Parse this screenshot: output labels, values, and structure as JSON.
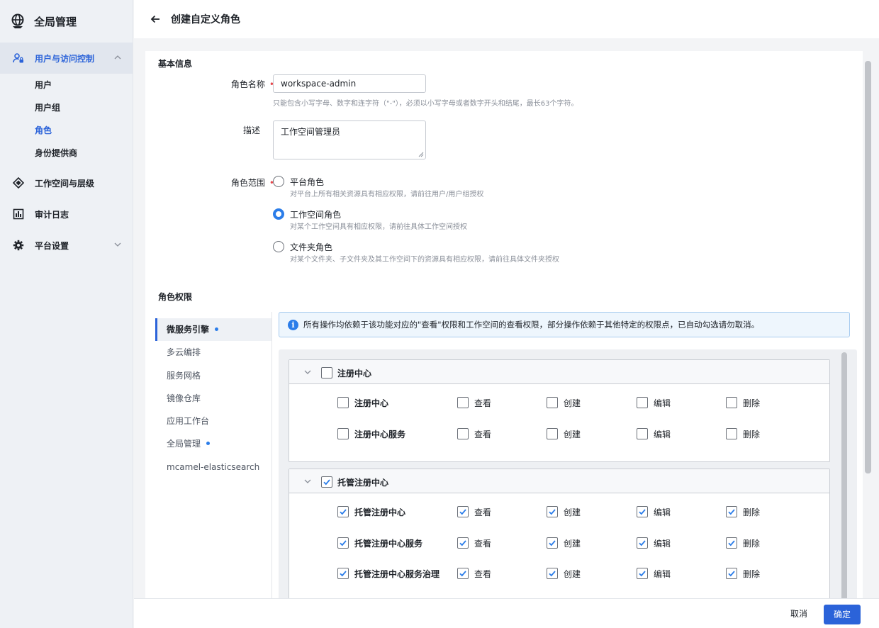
{
  "sidebar": {
    "brand": "全局管理",
    "groups": [
      {
        "label": "用户与访问控制"
      },
      {
        "label": "工作空间与层级"
      },
      {
        "label": "审计日志"
      },
      {
        "label": "平台设置"
      }
    ],
    "sub_items": [
      {
        "label": "用户"
      },
      {
        "label": "用户组"
      },
      {
        "label": "角色"
      },
      {
        "label": "身份提供商"
      }
    ]
  },
  "header": {
    "title": "创建自定义角色"
  },
  "basic": {
    "section_title": "基本信息",
    "name_label": "角色名称",
    "name_value": "workspace-admin",
    "name_hint": "只能包含小写字母、数字和连字符（\"-\"），必须以小写字母或者数字开头和结尾，最长63个字符。",
    "desc_label": "描述",
    "desc_value": "工作空间管理员",
    "scope_label": "角色范围",
    "scopes": [
      {
        "title": "平台角色",
        "desc": "对平台上所有相关资源具有相应权限，请前往用户/用户组授权",
        "checked": false
      },
      {
        "title": "工作空间角色",
        "desc": "对某个工作空间具有相应权限，请前往具体工作空间授权",
        "checked": true
      },
      {
        "title": "文件夹角色",
        "desc": "对某个文件夹、子文件夹及其工作空间下的资源具有相应权限，请前往具体文件夹授权",
        "checked": false
      }
    ]
  },
  "permissions": {
    "section_title": "角色权限",
    "tabs": [
      {
        "label": "微服务引擎",
        "dot": true
      },
      {
        "label": "多云编排",
        "dot": false
      },
      {
        "label": "服务网格",
        "dot": false
      },
      {
        "label": "镜像仓库",
        "dot": false
      },
      {
        "label": "应用工作台",
        "dot": false
      },
      {
        "label": "全局管理",
        "dot": true
      },
      {
        "label": "mcamel-elasticsearch",
        "dot": false
      }
    ],
    "notice": "所有操作均依赖于该功能对应的\"查看\"权限和工作空间的查看权限，部分操作依赖于其他特定的权限点，已自动勾选请勿取消。",
    "ops": [
      "查看",
      "创建",
      "编辑",
      "删除"
    ],
    "groups": [
      {
        "name": "注册中心",
        "checked": false,
        "rows": [
          {
            "name": "注册中心",
            "checked": false
          },
          {
            "name": "注册中心服务",
            "checked": false
          }
        ]
      },
      {
        "name": "托管注册中心",
        "checked": true,
        "rows": [
          {
            "name": "托管注册中心",
            "checked": true
          },
          {
            "name": "托管注册中心服务",
            "checked": true
          },
          {
            "name": "托管注册中心服务治理",
            "checked": true
          }
        ]
      }
    ]
  },
  "footer": {
    "cancel": "取消",
    "ok": "确定"
  },
  "colors": {
    "accent": "#2b63d9",
    "checkbox": "#2b7de9",
    "required": "#e5484d"
  }
}
